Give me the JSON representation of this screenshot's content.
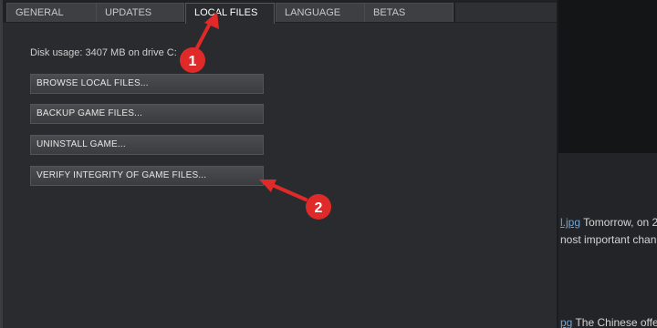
{
  "tabs": [
    {
      "label": "GENERAL",
      "active": false
    },
    {
      "label": "UPDATES",
      "active": false
    },
    {
      "label": "LOCAL FILES",
      "active": true
    },
    {
      "label": "LANGUAGE",
      "active": false
    },
    {
      "label": "BETAS",
      "active": false
    }
  ],
  "local_files": {
    "disk_usage": "Disk usage: 3407 MB on drive C:",
    "buttons": {
      "browse": "BROWSE LOCAL FILES...",
      "backup": "BACKUP GAME FILES...",
      "uninstall": "UNINSTALL GAME...",
      "verify": "VERIFY INTEGRITY OF GAME FILES..."
    }
  },
  "annotations": {
    "callout_1": "1",
    "callout_2": "2",
    "color": "#e02a2a"
  },
  "background_page": {
    "line_1_link": "l.jpg",
    "line_1_text": " Tomorrow, on 2",
    "line_2": "nost important chan",
    "line_3_link": "pg",
    "line_3_text": " The Chinese offe"
  }
}
